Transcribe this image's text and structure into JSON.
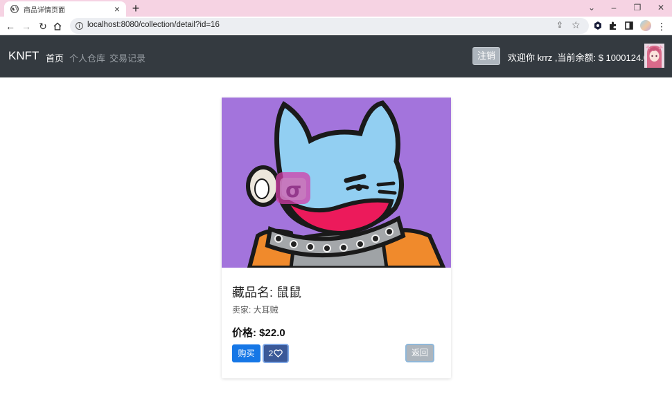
{
  "browser": {
    "tab_title": "商品详情页面",
    "url": "localhost:8080/collection/detail?id=16"
  },
  "navbar": {
    "brand": "KNFT",
    "links": [
      "首页",
      "个人仓库",
      "交易记录"
    ],
    "logout_label": "注销",
    "welcome_text": "欢迎你 krrz ,当前余额: $ 1000124.0"
  },
  "product": {
    "title": "藏品名: 鼠鼠",
    "seller": "卖家: 大耳贼",
    "price": "价格: $22.0",
    "buy_label": "购买",
    "like_count": "2",
    "back_label": "返回"
  },
  "colors": {
    "navbar_bg": "#343a40",
    "image_bg": "#a374dc",
    "cat_blue": "#92cff2",
    "mask_red": "#ec1a5b",
    "jacket_orange": "#f08a2c",
    "buy_button": "#1677e6",
    "like_button": "#3b5998",
    "back_button": "#adb5bd"
  },
  "icons": {
    "tab": "globe-icon",
    "like": "heart-icon"
  }
}
